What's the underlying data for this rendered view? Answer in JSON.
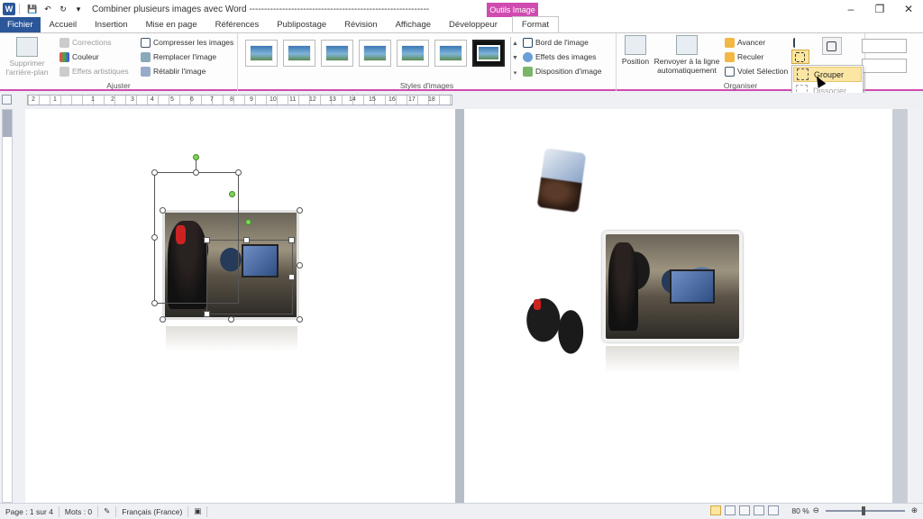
{
  "window": {
    "title": "Combiner plusieurs images avec Word ------------------------------------------------------------",
    "app_icon": "W",
    "controls": {
      "minimize": "–",
      "restore": "❐",
      "close": "✕"
    }
  },
  "context_tab_header": "Outils Image",
  "tabs": [
    {
      "label": "Fichier"
    },
    {
      "label": "Accueil"
    },
    {
      "label": "Insertion"
    },
    {
      "label": "Mise en page"
    },
    {
      "label": "Références"
    },
    {
      "label": "Publipostage"
    },
    {
      "label": "Révision"
    },
    {
      "label": "Affichage"
    },
    {
      "label": "Développeur"
    },
    {
      "label": "Format"
    }
  ],
  "ribbon": {
    "ajuster": {
      "label": "Ajuster",
      "remove_bg": "Supprimer l'arrière-plan",
      "corrections": "Corrections",
      "couleur": "Couleur",
      "effets_artistiques": "Effets artistiques",
      "compresser": "Compresser les images",
      "remplacer": "Remplacer l'image",
      "retablir": "Rétablir l'image"
    },
    "styles": {
      "label": "Styles d'images",
      "bord": "Bord de l'image",
      "effets": "Effets des images",
      "disposition": "Disposition d'image"
    },
    "organiser": {
      "label": "Organiser",
      "position": "Position",
      "renvoyer": "Renvoyer à la ligne automatiquement",
      "avancer": "Avancer",
      "reculer": "Reculer",
      "volet": "Volet Sélection"
    },
    "group_menu": {
      "grouper": "Grouper",
      "dissocier": "Dissocier"
    }
  },
  "ruler": {
    "numbers": [
      "2",
      "1",
      "1",
      "2",
      "3",
      "4",
      "5",
      "6",
      "7",
      "8",
      "9",
      "10",
      "11",
      "12",
      "13",
      "14",
      "15",
      "16",
      "17",
      "18"
    ]
  },
  "status": {
    "page": "Page : 1 sur 4",
    "words": "Mots : 0",
    "language": "Français (France)",
    "zoom": "80 %"
  },
  "colors": {
    "word_blue": "#2b579a",
    "context_magenta": "#d04bb0",
    "menu_highlight": "#fce6a4",
    "rotation_handle": "#7ed25a"
  }
}
